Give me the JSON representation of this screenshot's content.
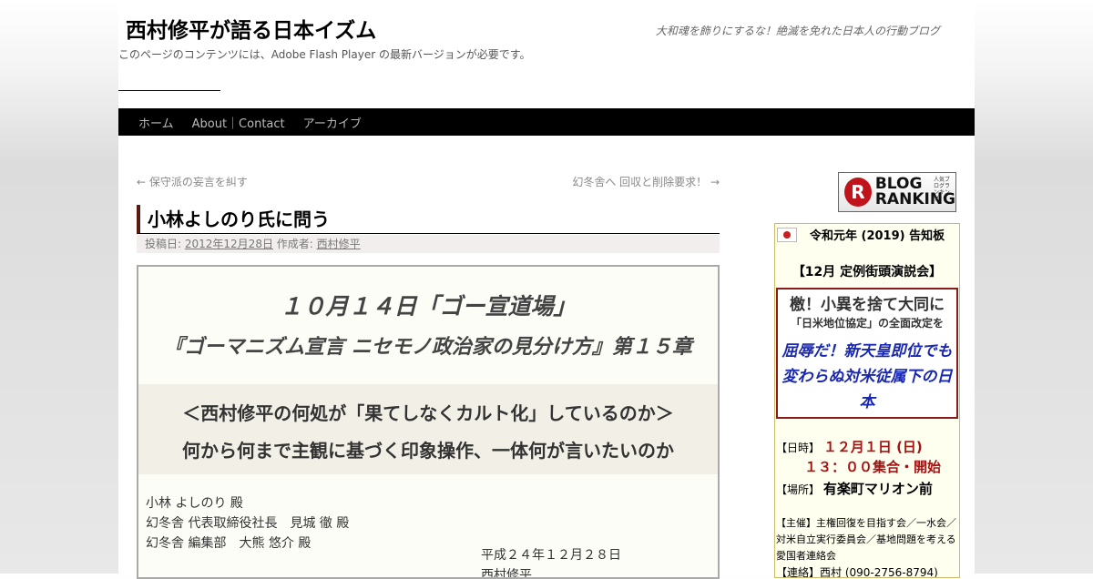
{
  "header": {
    "site_title": "西村修平が語る日本イズム",
    "site_description": "大和魂を飾りにするな！絶滅を免れた日本人の行動ブログ",
    "flash_notice": "このページのコンテンツには、Adobe Flash Player の最新バージョンが必要です。"
  },
  "nav": {
    "items": [
      {
        "label": "ホーム"
      },
      {
        "label": "About｜Contact"
      },
      {
        "label": "アーカイブ"
      }
    ]
  },
  "post_nav": {
    "prev": "← 保守派の妄言を糾す",
    "next": "幻冬舎へ 回収と削除要求！ →"
  },
  "entry": {
    "title": "小林よしのり氏に問う",
    "meta_posted_label": "投稿日:",
    "meta_date": "2012年12月28日",
    "meta_author_label": "作成者:",
    "meta_author": "西村修平",
    "headline1": "１０月１４日「ゴー宣道場」",
    "headline2": "『ゴーマニズム宣言 ニセモノ政治家の見分け方』第１５章",
    "band_line1": "＜西村修平の何処が「果てしなくカルト化」しているのか＞",
    "band_line2": "何から何まで主観に基づく印象操作、一体何が言いたいのか",
    "addressee1": "小林 よしのり 殿",
    "addressee2": "幻冬舎 代表取締役社長　見城 徹 殿",
    "addressee3": "幻冬舎 編集部　大熊 悠介 殿",
    "letter_date": "平成２４年１２月２８日",
    "letter_author": "西村修平"
  },
  "sidebar": {
    "ranking_badge": {
      "letter": "R",
      "line1": "BLOG",
      "line2": "RANKING",
      "small": "人気ブログランキング"
    },
    "notice_title": "令和元年 (2019) 告知板",
    "regular_event": "【12月 定例街頭演説会】",
    "slogan1": "檄！小異を捨て大同に",
    "slogan2": "「日米地位協定」の全面改定を",
    "slogan3": "屈辱だ！新天皇即位でも変わらぬ対米従属下の日本",
    "date_label": "【日時】",
    "date_value": "１２月１日 (日)",
    "time_value": "１３：００集合・開始",
    "place_label": "【場所】",
    "place_value": "有楽町マリオン前",
    "organizer": "【主催】主権回復を目指す会／一水会／対米自立実行委員会／基地問題を考える愛国者連絡会",
    "contact": "【連絡】西村 (090-2756-8794)"
  }
}
